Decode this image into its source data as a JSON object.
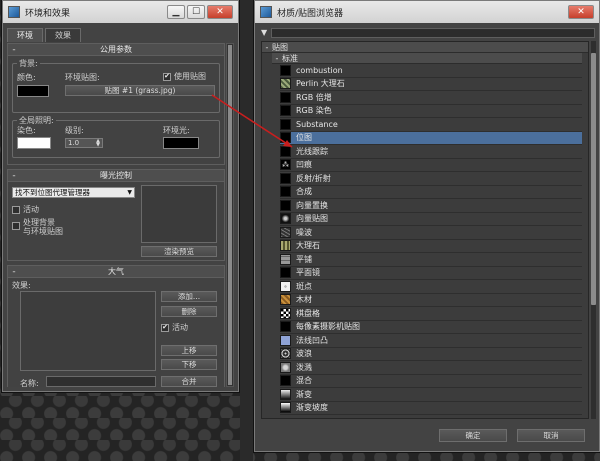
{
  "env": {
    "title": "环境和效果",
    "tabs": [
      "环境",
      "效果"
    ],
    "common": {
      "title": "公用参数",
      "background_group": "背景:",
      "color_label": "颜色:",
      "envmap_label": "环境贴图:",
      "use_map_label": "使用贴图",
      "map_button": "贴图 #1 (grass.jpg)",
      "global_group": "全局照明:",
      "tint_label": "染色:",
      "level_label": "级别:",
      "level_value": "1.0",
      "ambient_label": "环境光:"
    },
    "exposure": {
      "title": "曝光控制",
      "dropdown": "找不到位图代理管理器",
      "active_label": "活动",
      "process_bg_1": "处理背景",
      "process_bg_2": "与环境贴图",
      "render_preview": "渲染预览"
    },
    "atmosphere": {
      "title": "大气",
      "effects_label": "效果:",
      "add": "添加...",
      "delete": "删除",
      "active": "活动",
      "move_up": "上移",
      "move_down": "下移",
      "name_label": "名称:",
      "merge": "合并"
    }
  },
  "mat": {
    "title": "材质/贴图浏览器",
    "category": "贴图",
    "subcategory": "标准",
    "items": [
      {
        "label": "combustion",
        "icon": "black-thumb-icon"
      },
      {
        "label": "Perlin 大理石",
        "icon": "marble-thumb-icon"
      },
      {
        "label": "RGB 倍增",
        "icon": "black-thumb-icon"
      },
      {
        "label": "RGB 染色",
        "icon": "black-thumb-icon"
      },
      {
        "label": "Substance",
        "icon": "black-thumb-icon"
      },
      {
        "label": "位图",
        "icon": "bitmap-thumb-icon"
      },
      {
        "label": "光线跟踪",
        "icon": "black-thumb-icon"
      },
      {
        "label": "凹痕",
        "icon": "dent-thumb-icon"
      },
      {
        "label": "反射/折射",
        "icon": "black-thumb-icon"
      },
      {
        "label": "合成",
        "icon": "black-thumb-icon"
      },
      {
        "label": "向量置换",
        "icon": "black-thumb-icon"
      },
      {
        "label": "向量贴图",
        "icon": "vector-thumb-icon"
      },
      {
        "label": "噪波",
        "icon": "noise-thumb-icon"
      },
      {
        "label": "大理石",
        "icon": "marble2-thumb-icon"
      },
      {
        "label": "平铺",
        "icon": "tiles-thumb-icon"
      },
      {
        "label": "平面镜",
        "icon": "black-thumb-icon"
      },
      {
        "label": "斑点",
        "icon": "speckle-thumb-icon"
      },
      {
        "label": "木材",
        "icon": "wood-thumb-icon"
      },
      {
        "label": "棋盘格",
        "icon": "checker-thumb-icon"
      },
      {
        "label": "每像素摄影机贴图",
        "icon": "black-thumb-icon"
      },
      {
        "label": "法线凹凸",
        "icon": "normal-thumb-icon"
      },
      {
        "label": "波浪",
        "icon": "waves-thumb-icon"
      },
      {
        "label": "泼溅",
        "icon": "splat-thumb-icon"
      },
      {
        "label": "混合",
        "icon": "black-thumb-icon"
      },
      {
        "label": "渐变",
        "icon": "gradient-thumb-icon"
      },
      {
        "label": "渐变坡度",
        "icon": "ramp-thumb-icon"
      }
    ],
    "ok": "确定",
    "cancel": "取消"
  },
  "colors": {
    "annotation_arrow": "#c81e1e",
    "selection": "#4b6f9c"
  }
}
